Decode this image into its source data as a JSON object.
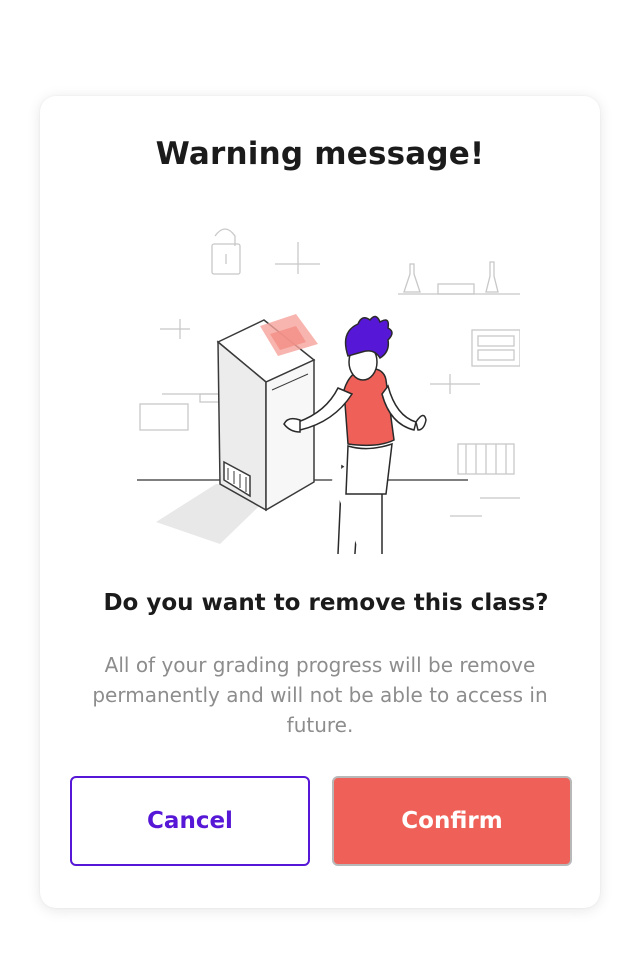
{
  "dialog": {
    "title": "Warning message!",
    "question": "Do you want to remove this class?",
    "description": "All of your grading progress will be remove permanently and will not be able to access in future.",
    "cancel_label": "Cancel",
    "confirm_label": "Confirm"
  },
  "colors": {
    "accent_purple": "#5617d6",
    "confirm_red": "#ef6158",
    "title_text": "#1b1b1b",
    "description_text": "#8d8d8d"
  },
  "illustration": {
    "icon": "person-shredding-document-illustration"
  }
}
